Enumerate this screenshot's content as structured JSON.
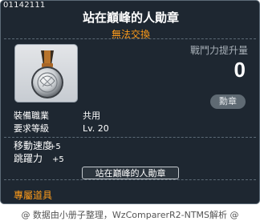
{
  "item": {
    "id": "01142111",
    "name": "站在巔峰的人勛章",
    "trade_note": "無法交換",
    "icon": "medal-icon",
    "power_label": "戰鬥力提升量",
    "power_value": "0",
    "badge_label": "勳章",
    "job_label": "裝備職業",
    "job_value": "共用",
    "level_label": "要求等級",
    "level_value": "Lv. 20",
    "stats": [
      {
        "label": "移動速度",
        "value": "+5"
      },
      {
        "label": "跳躍力",
        "value": "+5"
      }
    ],
    "title_button": "站在巔峰的人勛章",
    "exclusive_label": "專屬道具"
  },
  "footer": {
    "credit": "@ 数据由小册子整理，WzComparerR2-NTMS解析 @"
  },
  "colors": {
    "background": "#1e2731",
    "accent_orange": "#ff9c1a",
    "text_white": "#ffffff",
    "muted": "#a8b0b8"
  }
}
